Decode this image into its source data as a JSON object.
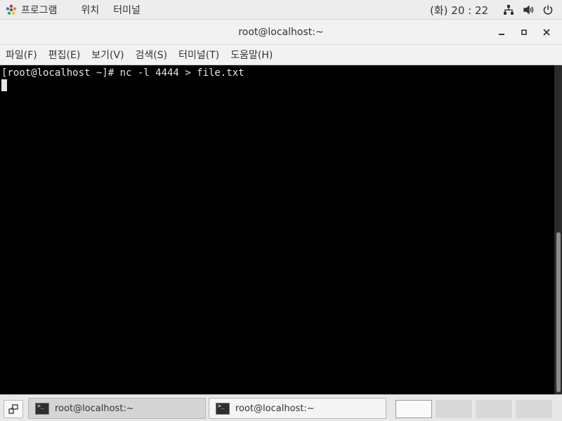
{
  "topbar": {
    "menus": [
      "프로그램",
      "위치",
      "터미널"
    ],
    "clock": "(화) 20 : 22"
  },
  "window": {
    "title": "root@localhost:~"
  },
  "menubar": {
    "items": [
      "파일(F)",
      "편집(E)",
      "보기(V)",
      "검색(S)",
      "터미널(T)",
      "도움말(H)"
    ]
  },
  "terminal": {
    "lines": [
      "[root@localhost ~]# nc -l 4444 > file.txt"
    ]
  },
  "taskbar": {
    "tasks": [
      {
        "label": "root@localhost:~",
        "active": true
      },
      {
        "label": "root@localhost:~",
        "active": false
      }
    ],
    "workspaces": 4,
    "active_workspace": 1
  },
  "colors": {
    "terminal_bg": "#000000",
    "terminal_fg": "#e5e5e5",
    "panel_bg": "#ededed"
  }
}
